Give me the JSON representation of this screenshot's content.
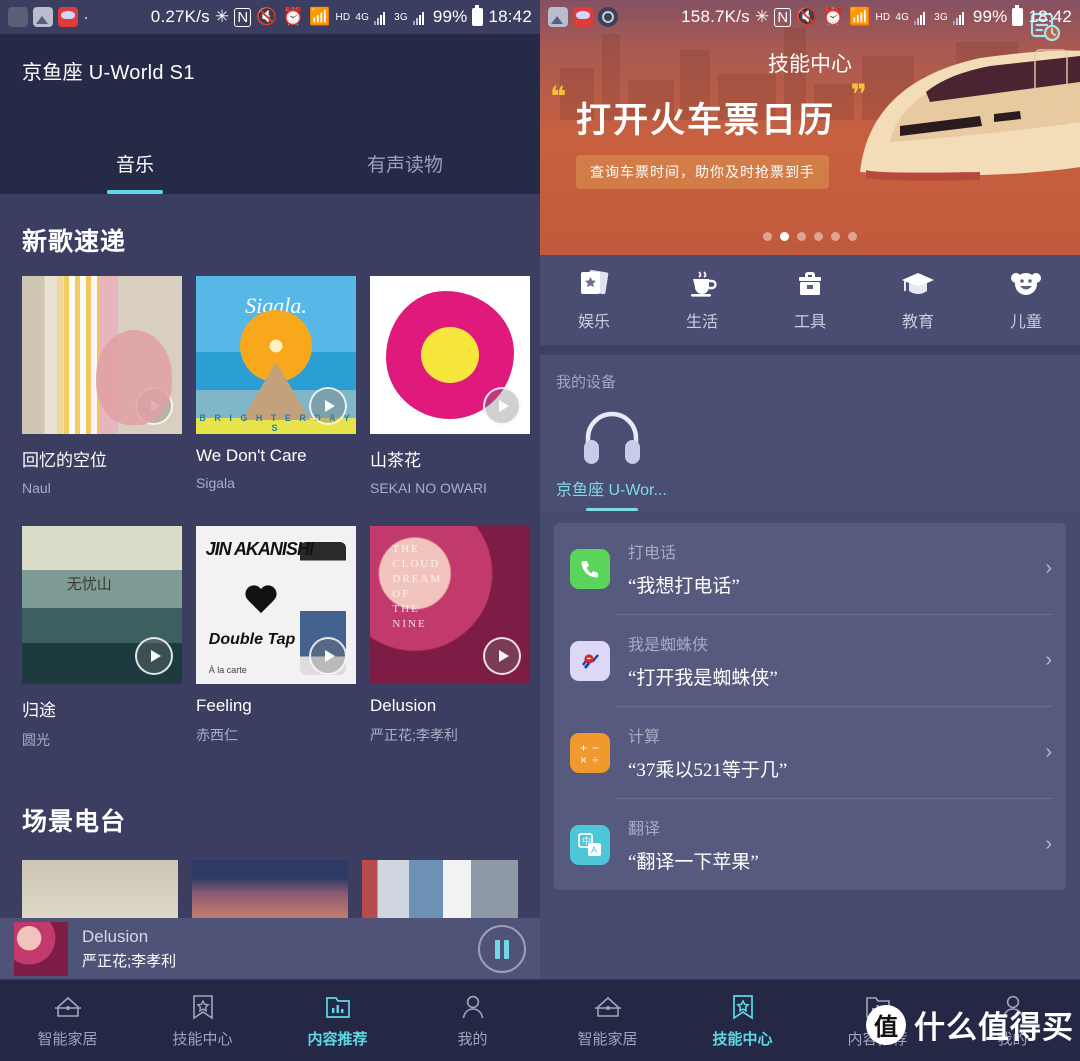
{
  "left": {
    "status": {
      "speed": "0.27K/s",
      "icons": [
        "bluetooth-icon",
        "nfc-icon",
        "mute-icon",
        "alarm-icon",
        "wifi-icon"
      ],
      "hd": "HD",
      "sim1": "4G",
      "sim2": "3G",
      "battery": "99%",
      "time": "18:42"
    },
    "header": {
      "title": "京鱼座 U-World S1"
    },
    "tabs": [
      {
        "label": "音乐",
        "active": true
      },
      {
        "label": "有声读物",
        "active": false
      }
    ],
    "sections": [
      {
        "title": "新歌速递"
      },
      {
        "title": "场景电台"
      }
    ],
    "songs_row1": [
      {
        "name": "回忆的空位",
        "artist": "Naul"
      },
      {
        "name": "We Don't Care",
        "artist": "Sigala"
      },
      {
        "name": "山茶花",
        "artist": "SEKAI NO OWARI"
      }
    ],
    "songs_row2": [
      {
        "name": "归途",
        "artist": "圆光"
      },
      {
        "name": "Feeling",
        "artist": "赤西仁"
      },
      {
        "name": "Delusion",
        "artist": "严正花;李孝利"
      }
    ],
    "album_art_text": {
      "sigala_wordmark": "Sigala.",
      "sigala_bottom": "B R I G H T E R   D A Y S",
      "guitu_cal": "无忧山",
      "feeling_scrawl": "JIN AKANISHI",
      "feeling_double": "Double Tap",
      "feeling_alacarte": "À la carte",
      "delusion_text": "THE\nCLOUD\nDREAM\nOF\nTHE\nNINE"
    },
    "mini_player": {
      "title": "Delusion",
      "artist": "严正花;李孝利",
      "button": "pause-icon"
    },
    "nav": [
      {
        "label": "智能家居",
        "icon": "home-icon",
        "active": false
      },
      {
        "label": "技能中心",
        "icon": "bookmark-star-icon",
        "active": false
      },
      {
        "label": "内容推荐",
        "icon": "folder-chart-icon",
        "active": true
      },
      {
        "label": "我的",
        "icon": "person-icon",
        "active": false
      }
    ]
  },
  "right": {
    "status": {
      "speed": "158.7K/s",
      "hd": "HD",
      "sim1": "4G",
      "sim2": "3G",
      "battery": "99%",
      "time": "18:42"
    },
    "header": {
      "title": "技能中心",
      "action_icon": "history-list-icon"
    },
    "banner": {
      "headline": "打开火车票日历",
      "subtitle": "查询车票时间，助你及时抢票到手",
      "quote_left": "❝",
      "quote_right": "❞",
      "dots_total": 6,
      "dots_active_index": 1
    },
    "categories": [
      {
        "label": "娱乐",
        "icon": "cards-star-icon"
      },
      {
        "label": "生活",
        "icon": "coffee-cup-icon"
      },
      {
        "label": "工具",
        "icon": "toolbox-icon"
      },
      {
        "label": "教育",
        "icon": "graduation-cap-icon"
      },
      {
        "label": "儿童",
        "icon": "child-face-icon"
      }
    ],
    "my_device": {
      "title": "我的设备",
      "device_name": "京鱼座 U-Wor...",
      "icon": "headphones-icon"
    },
    "skills": [
      {
        "title": "打电话",
        "phrase": "“我想打电话”",
        "icon": "phone-icon",
        "color": "#5bd45b"
      },
      {
        "title": "我是蜘蛛侠",
        "phrase": "“打开我是蜘蛛侠”",
        "icon": "spiderman-icon",
        "color": "#dcd8f5"
      },
      {
        "title": "计算",
        "phrase": "“37乘以521等于几”",
        "icon": "calculator-icon",
        "color": "#f0992e"
      },
      {
        "title": "翻译",
        "phrase": "“翻译一下苹果”",
        "icon": "translate-icon",
        "color": "#4dc6d8"
      }
    ],
    "nav": [
      {
        "label": "智能家居",
        "icon": "home-icon",
        "active": false
      },
      {
        "label": "技能中心",
        "icon": "bookmark-star-icon",
        "active": true
      },
      {
        "label": "内容推荐",
        "icon": "folder-chart-icon",
        "active": false
      },
      {
        "label": "我的",
        "icon": "person-icon",
        "active": false
      }
    ]
  },
  "watermark": {
    "badge": "值",
    "text": "什么值得买"
  },
  "colors": {
    "accent": "#5ed8e6",
    "header_bg": "#252a46",
    "content_bg": "#3b3e60",
    "right_bg": "#474b70"
  }
}
